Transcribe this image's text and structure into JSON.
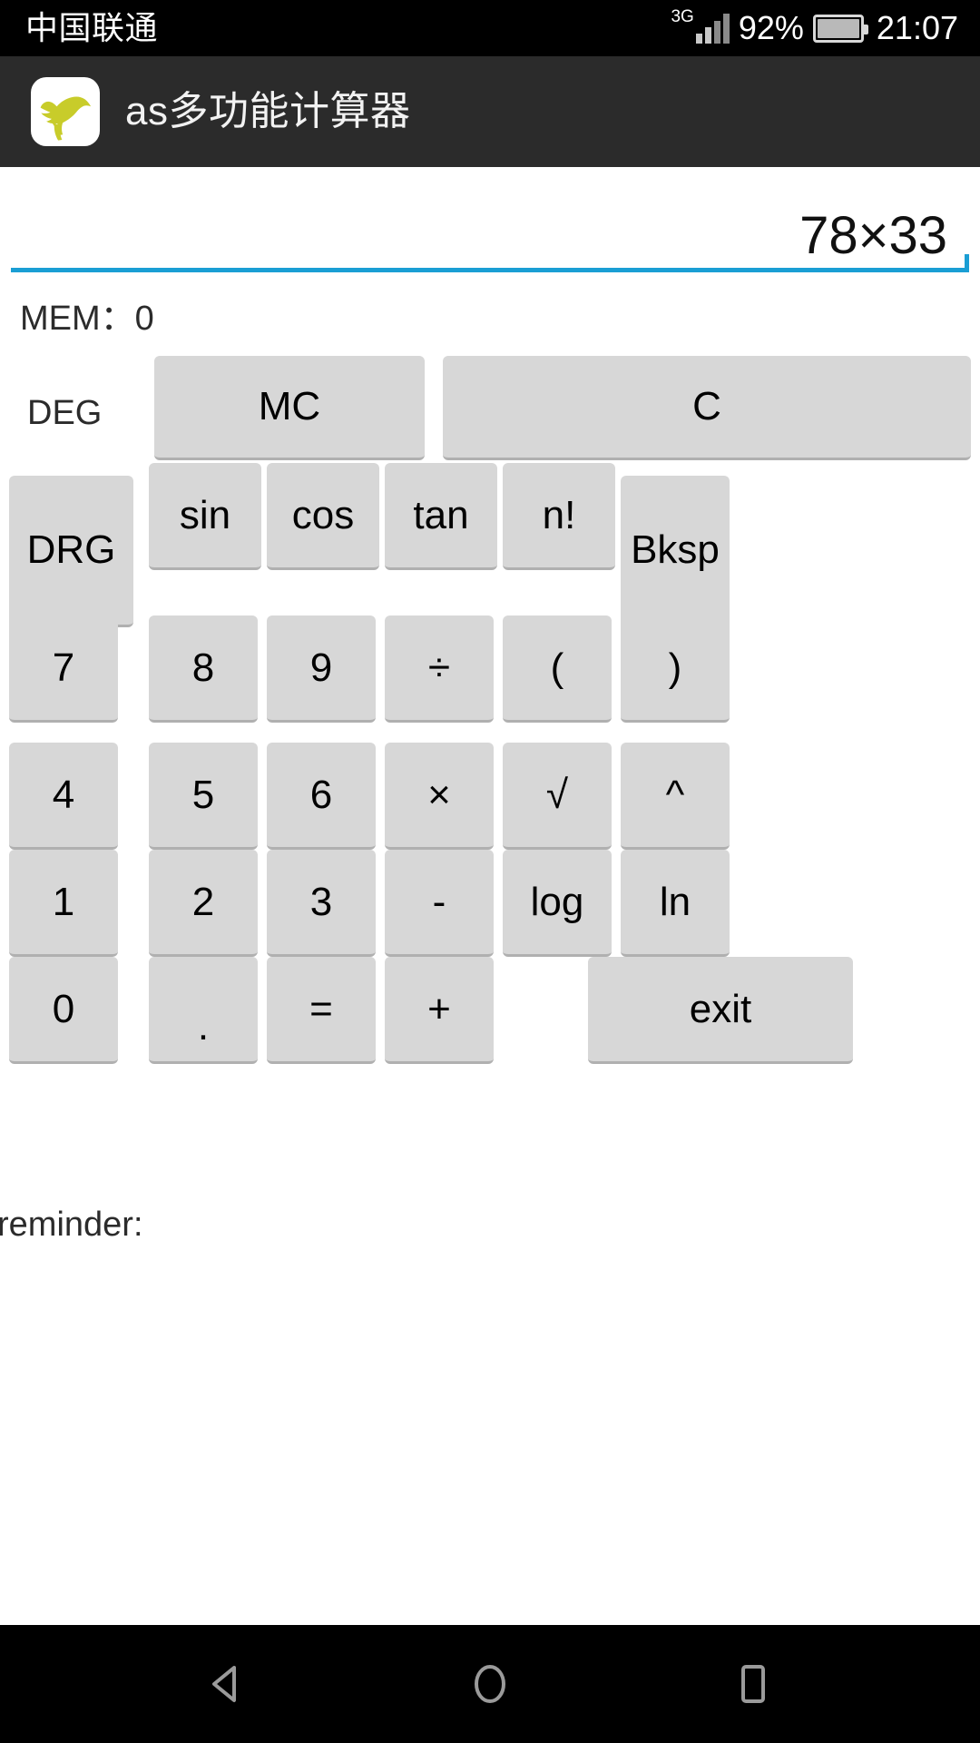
{
  "status_bar": {
    "carrier": "中国联通",
    "network_type": "3G",
    "battery_percent": "92%",
    "time": "21:07",
    "signal_icon": "signal-bars-icon",
    "battery_icon": "battery-icon"
  },
  "app_bar": {
    "icon_name": "puma-logo-icon",
    "icon_color": "#c8cc2a",
    "title": "as多功能计算器",
    "background": "#2b2b2b"
  },
  "display": {
    "expression": "78×33",
    "placeholder": "",
    "underline_color": "#1a9ed4"
  },
  "memory": {
    "label": "MEM：0"
  },
  "angle_mode": {
    "label": "DEG"
  },
  "keypad": {
    "rows": [
      {
        "keys": [
          {
            "label": "MC",
            "name": "key-mc"
          },
          {
            "label": "C",
            "name": "key-clear"
          }
        ]
      },
      {
        "keys": [
          {
            "label": "DRG",
            "name": "key-drg"
          },
          {
            "label": "sin",
            "name": "key-sin"
          },
          {
            "label": "cos",
            "name": "key-cos"
          },
          {
            "label": "tan",
            "name": "key-tan"
          },
          {
            "label": "n!",
            "name": "key-factorial"
          },
          {
            "label": "Bksp",
            "name": "key-backspace"
          }
        ]
      },
      {
        "keys": [
          {
            "label": "7",
            "name": "key-7"
          },
          {
            "label": "8",
            "name": "key-8"
          },
          {
            "label": "9",
            "name": "key-9"
          },
          {
            "label": "÷",
            "name": "key-divide"
          },
          {
            "label": "(",
            "name": "key-open-paren"
          },
          {
            "label": ")",
            "name": "key-close-paren"
          }
        ]
      },
      {
        "keys": [
          {
            "label": "4",
            "name": "key-4"
          },
          {
            "label": "5",
            "name": "key-5"
          },
          {
            "label": "6",
            "name": "key-6"
          },
          {
            "label": "×",
            "name": "key-multiply"
          },
          {
            "label": "√",
            "name": "key-sqrt"
          },
          {
            "label": "^",
            "name": "key-power"
          }
        ]
      },
      {
        "keys": [
          {
            "label": "1",
            "name": "key-1"
          },
          {
            "label": "2",
            "name": "key-2"
          },
          {
            "label": "3",
            "name": "key-3"
          },
          {
            "label": "-",
            "name": "key-minus"
          },
          {
            "label": "log",
            "name": "key-log"
          },
          {
            "label": "ln",
            "name": "key-ln"
          }
        ]
      },
      {
        "keys": [
          {
            "label": "0",
            "name": "key-0"
          },
          {
            "label": ".",
            "name": "key-decimal"
          },
          {
            "label": "=",
            "name": "key-equals"
          },
          {
            "label": "+",
            "name": "key-plus"
          },
          {
            "label": "exit",
            "name": "key-exit"
          }
        ]
      }
    ]
  },
  "reminder": {
    "label": "reminder:"
  },
  "nav_bar": {
    "back": "back-icon",
    "home": "home-icon",
    "recents": "recents-icon"
  },
  "colors": {
    "button_face": "#d7d7d7",
    "button_shadow": "#b0b0b0",
    "accent": "#1a9ed4",
    "app_bar": "#2b2b2b",
    "status_bar": "#000000"
  }
}
